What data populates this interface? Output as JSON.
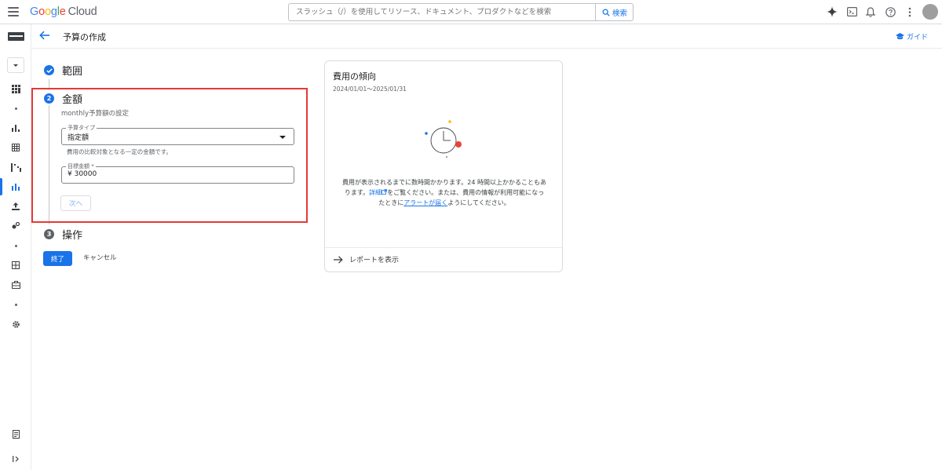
{
  "app": {
    "logo_google_letters": [
      "G",
      "o",
      "o",
      "g",
      "l",
      "e"
    ],
    "logo_cloud": "Cloud"
  },
  "search": {
    "placeholder": "スラッシュ（/）を使用してリソース、ドキュメント、プロダクトなどを検索",
    "button_label": "検索"
  },
  "header": {
    "page_title": "予算の作成",
    "guide_label": "ガイド"
  },
  "steps": [
    {
      "number": "✓",
      "title": "範囲",
      "state": "completed"
    },
    {
      "number": "2",
      "title": "金額",
      "state": "active"
    },
    {
      "number": "3",
      "title": "操作",
      "state": "pending"
    }
  ],
  "amount_step": {
    "subtitle": "monthly予算額の設定",
    "budget_type": {
      "label": "予算タイプ",
      "value": "指定額",
      "helper": "費用の比較対象となる一定の金額です。"
    },
    "target_amount": {
      "label": "目標金額 *",
      "currency": "¥",
      "value": "30000"
    },
    "next_label": "次へ"
  },
  "actions": {
    "finish_label": "終了",
    "cancel_label": "キャンセル"
  },
  "cost_trend": {
    "title": "費用の傾向",
    "date_range": "2024/01/01～2025/01/31",
    "message_part1": "費用が表示されるまでに数時間かかります。24 時間以上かかることもあります。",
    "details_link": "詳細",
    "message_part2": "をご覧ください。または、費用の情報が利用可能になったときに",
    "alert_link": "アラートが届く",
    "message_part3": "ようにしてください。",
    "report_link": "レポートを表示"
  },
  "colors": {
    "accent": "#1a73e8",
    "highlight_border": "#e53935",
    "step_completed": "#1a73e8",
    "step_pending": "#5f6368"
  }
}
